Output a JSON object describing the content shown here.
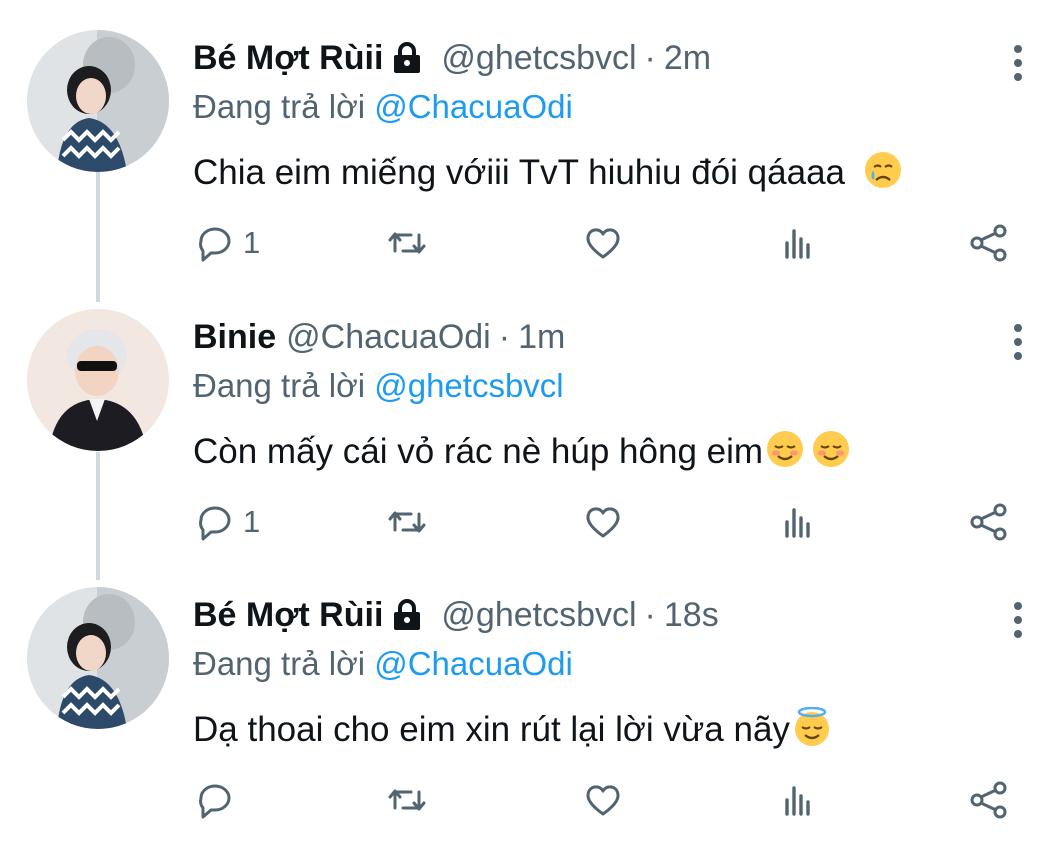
{
  "tweets": [
    {
      "name": "Bé Mợt Rùii",
      "locked": true,
      "handle": "@ghetcsbvcl",
      "separator": "·",
      "time": "2m",
      "replying_prefix": "Đang trả lời",
      "replying_to": "@ChacuaOdi",
      "text": "Chia eim miếng vớiii TvT hiuhiu đói qáaaa",
      "emoji": "crying-face",
      "reply_count": "1"
    },
    {
      "name": "Binie",
      "locked": false,
      "handle": "@ChacuaOdi",
      "separator": "·",
      "time": "1m",
      "replying_prefix": "Đang trả lời",
      "replying_to": "@ghetcsbvcl",
      "text": "Còn mấy cái vỏ rác nè húp hông eim",
      "emoji": "smiling-face x2",
      "reply_count": "1"
    },
    {
      "name": "Bé Mợt Rùii",
      "locked": true,
      "handle": "@ghetcsbvcl",
      "separator": "·",
      "time": "18s",
      "replying_prefix": "Đang trả lời",
      "replying_to": "@ChacuaOdi",
      "text": "Dạ thoai cho eim xin rút lại lời vừa nãy",
      "emoji": "smiling-face-with-halo",
      "reply_count": ""
    }
  ],
  "icons": [
    "reply-icon",
    "retweet-icon",
    "like-icon",
    "analytics-icon",
    "share-icon",
    "lock-icon",
    "more-icon"
  ],
  "colors": {
    "text": "#0f1419",
    "secondary": "#536471",
    "accent": "#1d9bf0",
    "thread_line": "#cfd9de"
  }
}
